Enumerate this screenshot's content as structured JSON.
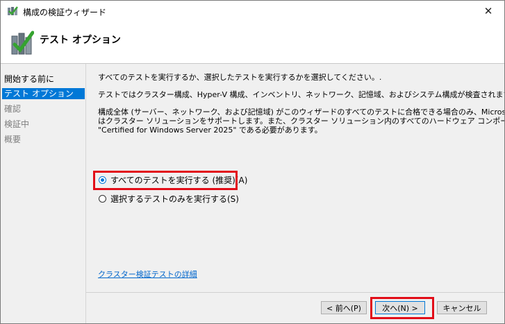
{
  "window": {
    "title": "構成の検証ウィザード",
    "close_glyph": "✕"
  },
  "header": {
    "title": "テスト オプション",
    "icon": "cluster-check-icon"
  },
  "sidebar": {
    "items": [
      {
        "label": "開始する前に",
        "state": "normal"
      },
      {
        "label": "テスト オプション",
        "state": "active"
      },
      {
        "label": "確認",
        "state": "disabled"
      },
      {
        "label": "検証中",
        "state": "disabled"
      },
      {
        "label": "概要",
        "state": "disabled"
      }
    ]
  },
  "main": {
    "intro": "すべてのテストを実行するか、選択したテストを実行するかを選択してください。.",
    "description": "テストではクラスター構成、Hyper-V 構成、インベントリ、ネットワーク、記憶域、およびシステム構成が検査されます。",
    "note_lines": [
      "構成全体 (サーバー、ネットワーク、および記憶域) がこのウィザードのすべてのテストに合格できる場合のみ、Microsoft",
      "はクラスター ソリューションをサポートします。また、クラスター ソリューション内のすべてのハードウェア コンポーネントは、",
      "\"Certified for Windows Server 2025\" である必要があります。"
    ],
    "options": [
      {
        "label": "すべてのテストを実行する (推奨)(A)",
        "checked": true
      },
      {
        "label": "選択するテストのみを実行する(S)",
        "checked": false
      }
    ],
    "details_link": "クラスター検証テストの詳細"
  },
  "buttons": {
    "back": "< 前へ(P)",
    "next": "次へ(N) >",
    "cancel": "キャンセル"
  },
  "colors": {
    "accent": "#0078d7",
    "highlight": "#e20d18",
    "link": "#0066cc"
  }
}
